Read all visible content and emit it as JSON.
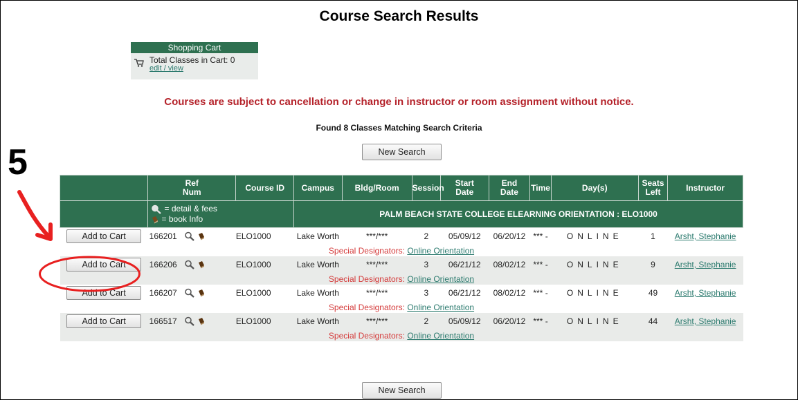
{
  "page": {
    "title": "Course Search Results"
  },
  "cart": {
    "header": "Shopping Cart",
    "total_label": "Total Classes in Cart: 0",
    "edit_link": "edit / view",
    "icon": "cart-icon"
  },
  "notice": "Courses are subject to cancellation or change in instructor or room assignment without notice.",
  "found_text": "Found 8 Classes Matching Search Criteria",
  "buttons": {
    "new_search": "New Search",
    "add_to_cart": "Add to Cart"
  },
  "annotation": {
    "step_number": "5",
    "arrow_color": "#e82020",
    "ellipse_color": "#e82020"
  },
  "table": {
    "headers": {
      "ref_line1": "Ref",
      "ref_line2": "Num",
      "course_id": "Course ID",
      "campus": "Campus",
      "bldg_room": "Bldg/Room",
      "session": "Session",
      "start_line1": "Start",
      "start_line2": "Date",
      "end_line1": "End",
      "end_line2": "Date",
      "time": "Time",
      "days": "Day(s)",
      "seats_line1": "Seats",
      "seats_line2": "Left",
      "instructor": "Instructor"
    },
    "legend": {
      "detail": "= detail & fees",
      "book": "= book Info",
      "course_title": "PALM BEACH STATE COLLEGE ELEARNING ORIENTATION : ELO1000"
    },
    "rows": [
      {
        "ref": "166201",
        "course_id": "ELO1000",
        "campus": "Lake Worth",
        "room": "***/***",
        "session": "2",
        "start": "05/09/12",
        "end": "06/20/12",
        "time": "*** -",
        "days": "ONLINE",
        "seats": "1",
        "instructor": "Arsht, Stephanie",
        "designator_label": "Special Designators:",
        "designator": "Online Orientation"
      },
      {
        "ref": "166206",
        "course_id": "ELO1000",
        "campus": "Lake Worth",
        "room": "***/***",
        "session": "3",
        "start": "06/21/12",
        "end": "08/02/12",
        "time": "*** -",
        "days": "ONLINE",
        "seats": "9",
        "instructor": "Arsht, Stephanie",
        "designator_label": "Special Designators:",
        "designator": "Online Orientation"
      },
      {
        "ref": "166207",
        "course_id": "ELO1000",
        "campus": "Lake Worth",
        "room": "***/***",
        "session": "3",
        "start": "06/21/12",
        "end": "08/02/12",
        "time": "*** -",
        "days": "ONLINE",
        "seats": "49",
        "instructor": "Arsht, Stephanie",
        "designator_label": "Special Designators:",
        "designator": "Online Orientation"
      },
      {
        "ref": "166517",
        "course_id": "ELO1000",
        "campus": "Lake Worth",
        "room": "***/***",
        "session": "2",
        "start": "05/09/12",
        "end": "06/20/12",
        "time": "*** -",
        "days": "ONLINE",
        "seats": "44",
        "instructor": "Arsht, Stephanie",
        "designator_label": "Special Designators:",
        "designator": "Online Orientation"
      }
    ]
  },
  "colors": {
    "header_green": "#2e7050",
    "notice_red": "#b5232b",
    "link_teal": "#2b7a6e",
    "row_shade": "#e9ebe9"
  }
}
